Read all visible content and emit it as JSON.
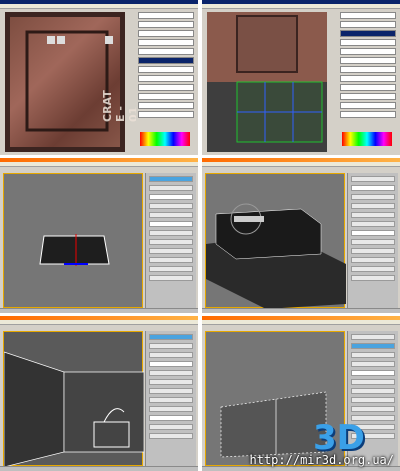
{
  "photoshop_panel_1": {
    "texture_text": "CRAT E - 01"
  },
  "watermark": {
    "logo_text": "3D",
    "url": "http://mir3d.org.ua/"
  },
  "colors": {
    "max_viewport_border": "#e6a800",
    "title_bar_orange": "#ff6a00",
    "photoshop_title": "#0a246a",
    "logo_blue": "#3aa0e8"
  }
}
